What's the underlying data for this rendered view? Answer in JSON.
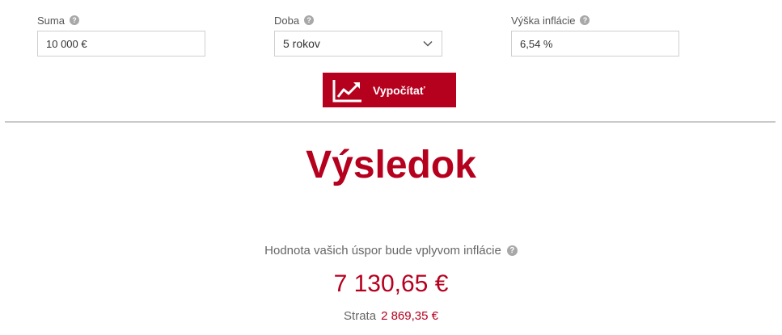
{
  "form": {
    "suma": {
      "label": "Suma",
      "value": "10 000 €"
    },
    "doba": {
      "label": "Doba",
      "value": "5 rokov"
    },
    "inflacia": {
      "label": "Výška inflácie",
      "value": "6,54 %"
    },
    "help_symbol": "?"
  },
  "button": {
    "label": "Vypočítať",
    "icon": "chart-trend-icon"
  },
  "result": {
    "title": "Výsledok",
    "description": "Hodnota vašich úspor bude vplyvom inflácie",
    "value": "7 130,65 €",
    "loss_label": "Strata",
    "loss_value": "2 869,35 €"
  },
  "colors": {
    "accent": "#b5001e",
    "help_icon": "#a8a8a8",
    "divider": "#c9c9c9"
  }
}
